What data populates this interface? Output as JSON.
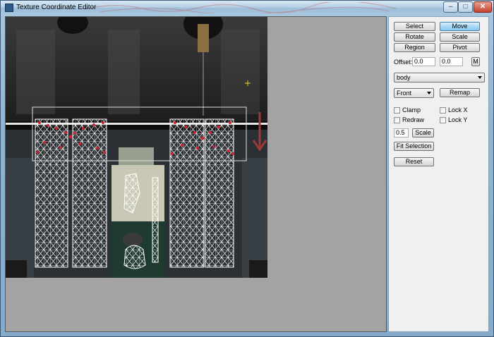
{
  "window": {
    "title": "Texture Coordinate Editor",
    "controls": {
      "minimize": "–",
      "maximize": "□",
      "close": "✕"
    }
  },
  "toolbar": {
    "select": "Select",
    "move": "Move",
    "rotate": "Rotate",
    "scale": "Scale",
    "region": "Region",
    "pivot": "Pivot",
    "active_mode": "Move"
  },
  "offset": {
    "label": "Offset:",
    "x": "0.0",
    "y": "0.0",
    "m_button": "M"
  },
  "mesh_select": {
    "value": "body"
  },
  "view_select": {
    "value": "Front"
  },
  "remap_button": "Remap",
  "options": {
    "clamp": {
      "label": "Clamp",
      "checked": false
    },
    "lock_x": {
      "label": "Lock X",
      "checked": false
    },
    "redraw": {
      "label": "Redraw",
      "checked": false
    },
    "lock_y": {
      "label": "Lock Y",
      "checked": false
    }
  },
  "scale_value": "0.5",
  "scale_button": "Scale",
  "fit_selection_button": "Fit Selection",
  "reset_button": "Reset",
  "colors": {
    "selection": "#d02030",
    "wire": "#ffffff",
    "cursor": "#e8d020",
    "drag_arrow": "#9c3a3a"
  }
}
